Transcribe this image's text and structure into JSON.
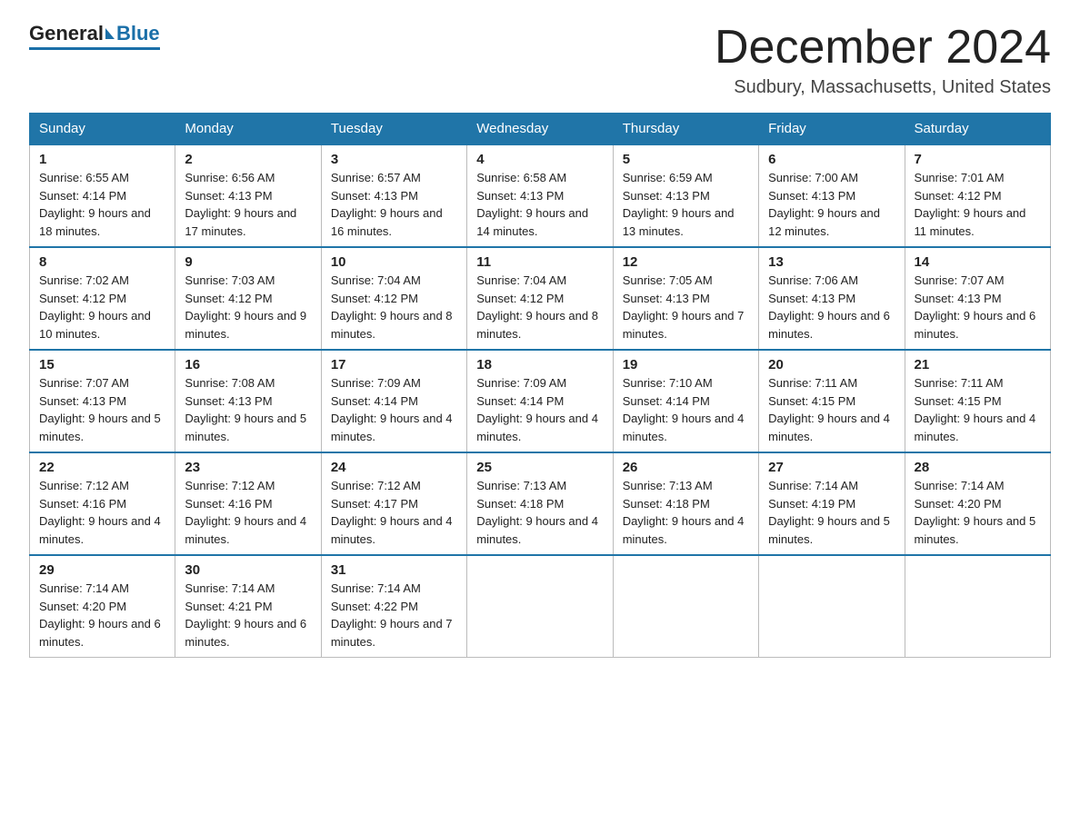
{
  "header": {
    "logo_general": "General",
    "logo_blue": "Blue",
    "month_title": "December 2024",
    "location": "Sudbury, Massachusetts, United States"
  },
  "days_of_week": [
    "Sunday",
    "Monday",
    "Tuesday",
    "Wednesday",
    "Thursday",
    "Friday",
    "Saturday"
  ],
  "weeks": [
    [
      {
        "day": "1",
        "sunrise": "6:55 AM",
        "sunset": "4:14 PM",
        "daylight": "9 hours and 18 minutes."
      },
      {
        "day": "2",
        "sunrise": "6:56 AM",
        "sunset": "4:13 PM",
        "daylight": "9 hours and 17 minutes."
      },
      {
        "day": "3",
        "sunrise": "6:57 AM",
        "sunset": "4:13 PM",
        "daylight": "9 hours and 16 minutes."
      },
      {
        "day": "4",
        "sunrise": "6:58 AM",
        "sunset": "4:13 PM",
        "daylight": "9 hours and 14 minutes."
      },
      {
        "day": "5",
        "sunrise": "6:59 AM",
        "sunset": "4:13 PM",
        "daylight": "9 hours and 13 minutes."
      },
      {
        "day": "6",
        "sunrise": "7:00 AM",
        "sunset": "4:13 PM",
        "daylight": "9 hours and 12 minutes."
      },
      {
        "day": "7",
        "sunrise": "7:01 AM",
        "sunset": "4:12 PM",
        "daylight": "9 hours and 11 minutes."
      }
    ],
    [
      {
        "day": "8",
        "sunrise": "7:02 AM",
        "sunset": "4:12 PM",
        "daylight": "9 hours and 10 minutes."
      },
      {
        "day": "9",
        "sunrise": "7:03 AM",
        "sunset": "4:12 PM",
        "daylight": "9 hours and 9 minutes."
      },
      {
        "day": "10",
        "sunrise": "7:04 AM",
        "sunset": "4:12 PM",
        "daylight": "9 hours and 8 minutes."
      },
      {
        "day": "11",
        "sunrise": "7:04 AM",
        "sunset": "4:12 PM",
        "daylight": "9 hours and 8 minutes."
      },
      {
        "day": "12",
        "sunrise": "7:05 AM",
        "sunset": "4:13 PM",
        "daylight": "9 hours and 7 minutes."
      },
      {
        "day": "13",
        "sunrise": "7:06 AM",
        "sunset": "4:13 PM",
        "daylight": "9 hours and 6 minutes."
      },
      {
        "day": "14",
        "sunrise": "7:07 AM",
        "sunset": "4:13 PM",
        "daylight": "9 hours and 6 minutes."
      }
    ],
    [
      {
        "day": "15",
        "sunrise": "7:07 AM",
        "sunset": "4:13 PM",
        "daylight": "9 hours and 5 minutes."
      },
      {
        "day": "16",
        "sunrise": "7:08 AM",
        "sunset": "4:13 PM",
        "daylight": "9 hours and 5 minutes."
      },
      {
        "day": "17",
        "sunrise": "7:09 AM",
        "sunset": "4:14 PM",
        "daylight": "9 hours and 4 minutes."
      },
      {
        "day": "18",
        "sunrise": "7:09 AM",
        "sunset": "4:14 PM",
        "daylight": "9 hours and 4 minutes."
      },
      {
        "day": "19",
        "sunrise": "7:10 AM",
        "sunset": "4:14 PM",
        "daylight": "9 hours and 4 minutes."
      },
      {
        "day": "20",
        "sunrise": "7:11 AM",
        "sunset": "4:15 PM",
        "daylight": "9 hours and 4 minutes."
      },
      {
        "day": "21",
        "sunrise": "7:11 AM",
        "sunset": "4:15 PM",
        "daylight": "9 hours and 4 minutes."
      }
    ],
    [
      {
        "day": "22",
        "sunrise": "7:12 AM",
        "sunset": "4:16 PM",
        "daylight": "9 hours and 4 minutes."
      },
      {
        "day": "23",
        "sunrise": "7:12 AM",
        "sunset": "4:16 PM",
        "daylight": "9 hours and 4 minutes."
      },
      {
        "day": "24",
        "sunrise": "7:12 AM",
        "sunset": "4:17 PM",
        "daylight": "9 hours and 4 minutes."
      },
      {
        "day": "25",
        "sunrise": "7:13 AM",
        "sunset": "4:18 PM",
        "daylight": "9 hours and 4 minutes."
      },
      {
        "day": "26",
        "sunrise": "7:13 AM",
        "sunset": "4:18 PM",
        "daylight": "9 hours and 4 minutes."
      },
      {
        "day": "27",
        "sunrise": "7:14 AM",
        "sunset": "4:19 PM",
        "daylight": "9 hours and 5 minutes."
      },
      {
        "day": "28",
        "sunrise": "7:14 AM",
        "sunset": "4:20 PM",
        "daylight": "9 hours and 5 minutes."
      }
    ],
    [
      {
        "day": "29",
        "sunrise": "7:14 AM",
        "sunset": "4:20 PM",
        "daylight": "9 hours and 6 minutes."
      },
      {
        "day": "30",
        "sunrise": "7:14 AM",
        "sunset": "4:21 PM",
        "daylight": "9 hours and 6 minutes."
      },
      {
        "day": "31",
        "sunrise": "7:14 AM",
        "sunset": "4:22 PM",
        "daylight": "9 hours and 7 minutes."
      },
      null,
      null,
      null,
      null
    ]
  ]
}
